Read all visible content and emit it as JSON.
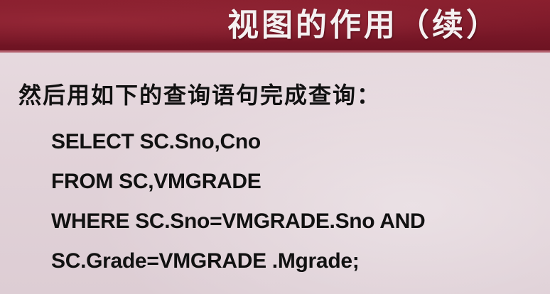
{
  "slide": {
    "title": "视图的作用（续）",
    "intro": "然后用如下的查询语句完成查询：",
    "sql_lines": [
      "SELECT SC.Sno,Cno",
      "FROM SC,VMGRADE",
      "WHERE SC.Sno=VMGRADE.Sno AND",
      "SC.Grade=VMGRADE .Mgrade;"
    ]
  },
  "colors": {
    "header_band": "#7a1828",
    "title_text": "#f5f0f1",
    "body_background": "#e2d3d9",
    "body_text": "#111111"
  }
}
